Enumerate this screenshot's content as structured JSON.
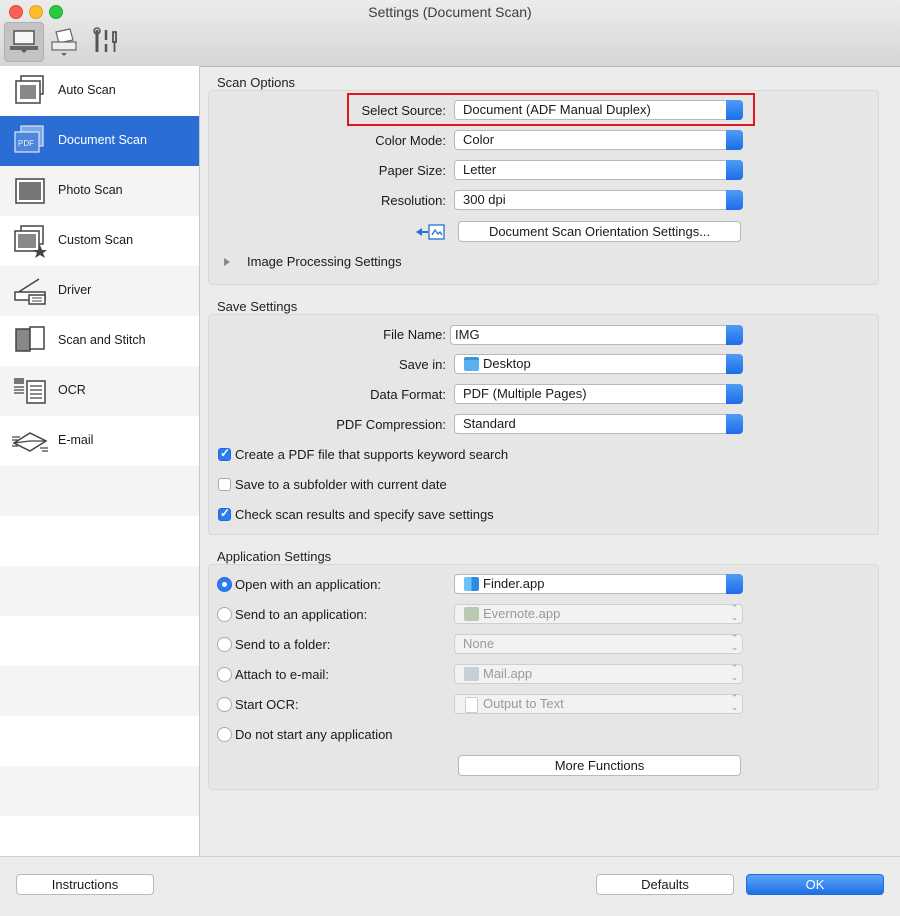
{
  "window": {
    "title": "Settings (Document Scan)"
  },
  "toolbar": {
    "tabs": [
      "scan-from-computer-icon",
      "scan-from-operation-panel-icon",
      "general-settings-icon"
    ]
  },
  "sidebar": {
    "items": [
      {
        "label": "Auto Scan",
        "icon": "auto-scan-icon"
      },
      {
        "label": "Document Scan",
        "icon": "document-scan-icon",
        "active": true
      },
      {
        "label": "Photo Scan",
        "icon": "photo-scan-icon"
      },
      {
        "label": "Custom Scan",
        "icon": "custom-scan-icon"
      },
      {
        "label": "Driver",
        "icon": "driver-icon"
      },
      {
        "label": "Scan and Stitch",
        "icon": "scan-and-stitch-icon"
      },
      {
        "label": "OCR",
        "icon": "ocr-icon"
      },
      {
        "label": "E-mail",
        "icon": "email-icon"
      }
    ]
  },
  "scan_options": {
    "title": "Scan Options",
    "select_source": {
      "label": "Select Source:",
      "value": "Document (ADF Manual Duplex)"
    },
    "color_mode": {
      "label": "Color Mode:",
      "value": "Color"
    },
    "paper_size": {
      "label": "Paper Size:",
      "value": "Letter"
    },
    "resolution": {
      "label": "Resolution:",
      "value": "300 dpi"
    },
    "orientation_button": "Document Scan Orientation Settings...",
    "image_processing": "Image Processing Settings"
  },
  "save_settings": {
    "title": "Save Settings",
    "file_name": {
      "label": "File Name:",
      "value": "IMG"
    },
    "save_in": {
      "label": "Save in:",
      "value": "Desktop"
    },
    "data_format": {
      "label": "Data Format:",
      "value": "PDF (Multiple Pages)"
    },
    "pdf_compression": {
      "label": "PDF Compression:",
      "value": "Standard"
    },
    "checkboxes": [
      {
        "label": "Create a PDF file that supports keyword search",
        "checked": true
      },
      {
        "label": "Save to a subfolder with current date",
        "checked": false
      },
      {
        "label": "Check scan results and specify save settings",
        "checked": true
      }
    ]
  },
  "app_settings": {
    "title": "Application Settings",
    "options": [
      {
        "label": "Open with an application:",
        "selected": true,
        "value": "Finder.app",
        "icon": "finder-icon"
      },
      {
        "label": "Send to an application:",
        "selected": false,
        "value": "Evernote.app",
        "icon": "evernote-icon"
      },
      {
        "label": "Send to a folder:",
        "selected": false,
        "value": "None"
      },
      {
        "label": "Attach to e-mail:",
        "selected": false,
        "value": "Mail.app",
        "icon": "mail-icon"
      },
      {
        "label": "Start OCR:",
        "selected": false,
        "value": "Output to Text",
        "icon": "text-document-icon"
      },
      {
        "label": "Do not start any application",
        "selected": false
      }
    ],
    "more_functions": "More Functions"
  },
  "footer": {
    "instructions": "Instructions",
    "defaults": "Defaults",
    "ok": "OK"
  },
  "colors": {
    "accent": "#2a6ed5",
    "highlight": "#e0171f"
  }
}
